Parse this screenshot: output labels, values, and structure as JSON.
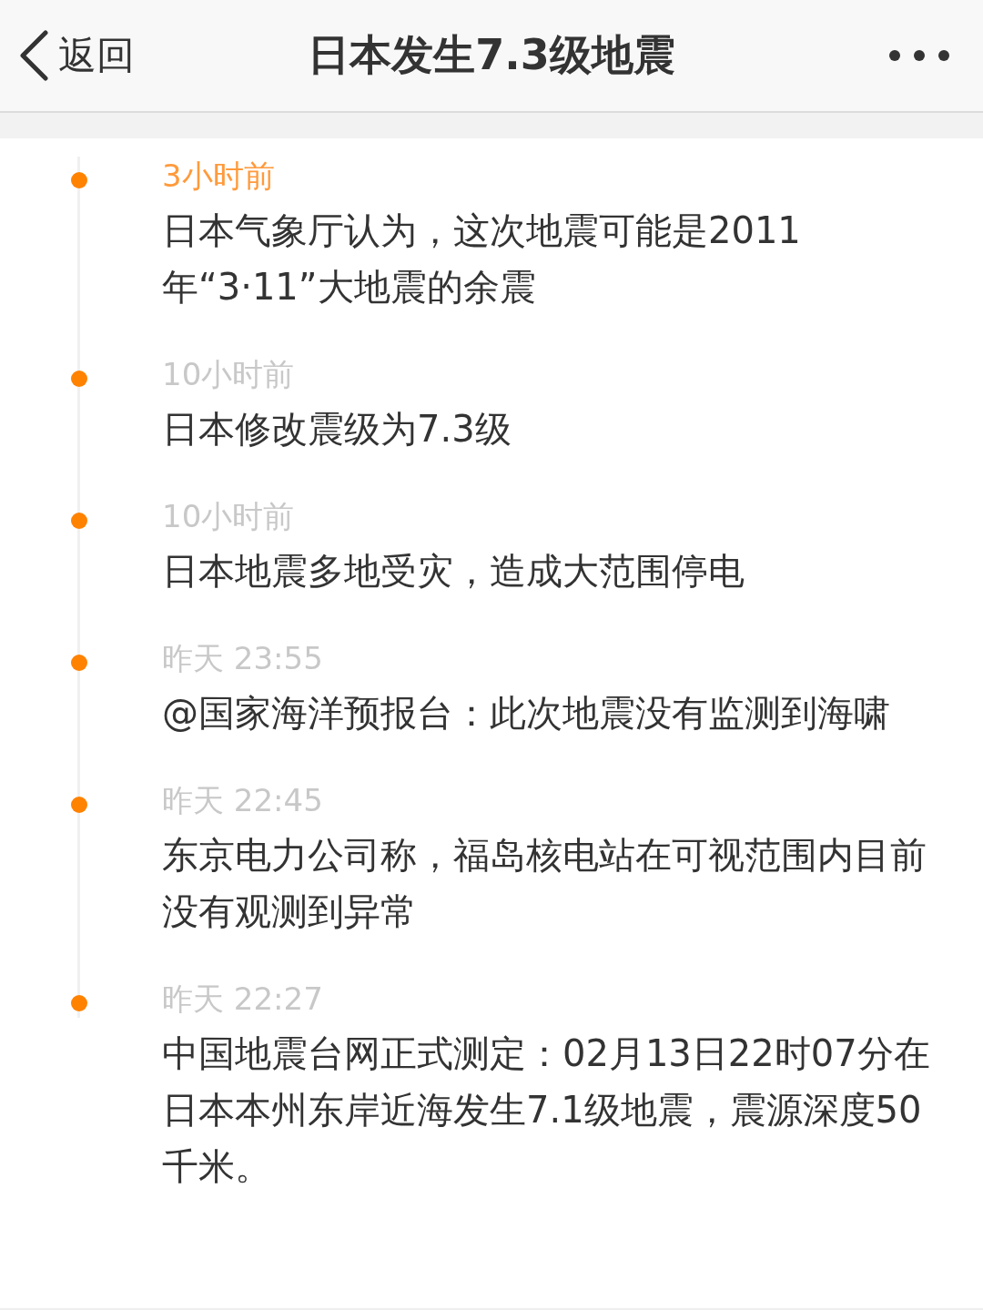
{
  "header": {
    "back_label": "返回",
    "title": "日本发生7.3级地震"
  },
  "timeline": [
    {
      "time": "3小时前",
      "latest": true,
      "text": "日本气象厅认为，这次地震可能是2011年“3·11”大地震的余震"
    },
    {
      "time": "10小时前",
      "latest": false,
      "text": "日本修改震级为7.3级"
    },
    {
      "time": "10小时前",
      "latest": false,
      "text": "日本地震多地受灾，造成大范围停电"
    },
    {
      "time": "昨天 23:55",
      "latest": false,
      "text": "@国家海洋预报台：此次地震没有监测到海啸"
    },
    {
      "time": "昨天 22:45",
      "latest": false,
      "text": "东京电力公司称，福岛核电站在可视范围内目前没有观测到异常"
    },
    {
      "time": "昨天 22:27",
      "latest": false,
      "text": "中国地震台网正式测定：02月13日22时07分在日本本州东岸近海发生7.1级地震，震源深度50千米。"
    }
  ]
}
